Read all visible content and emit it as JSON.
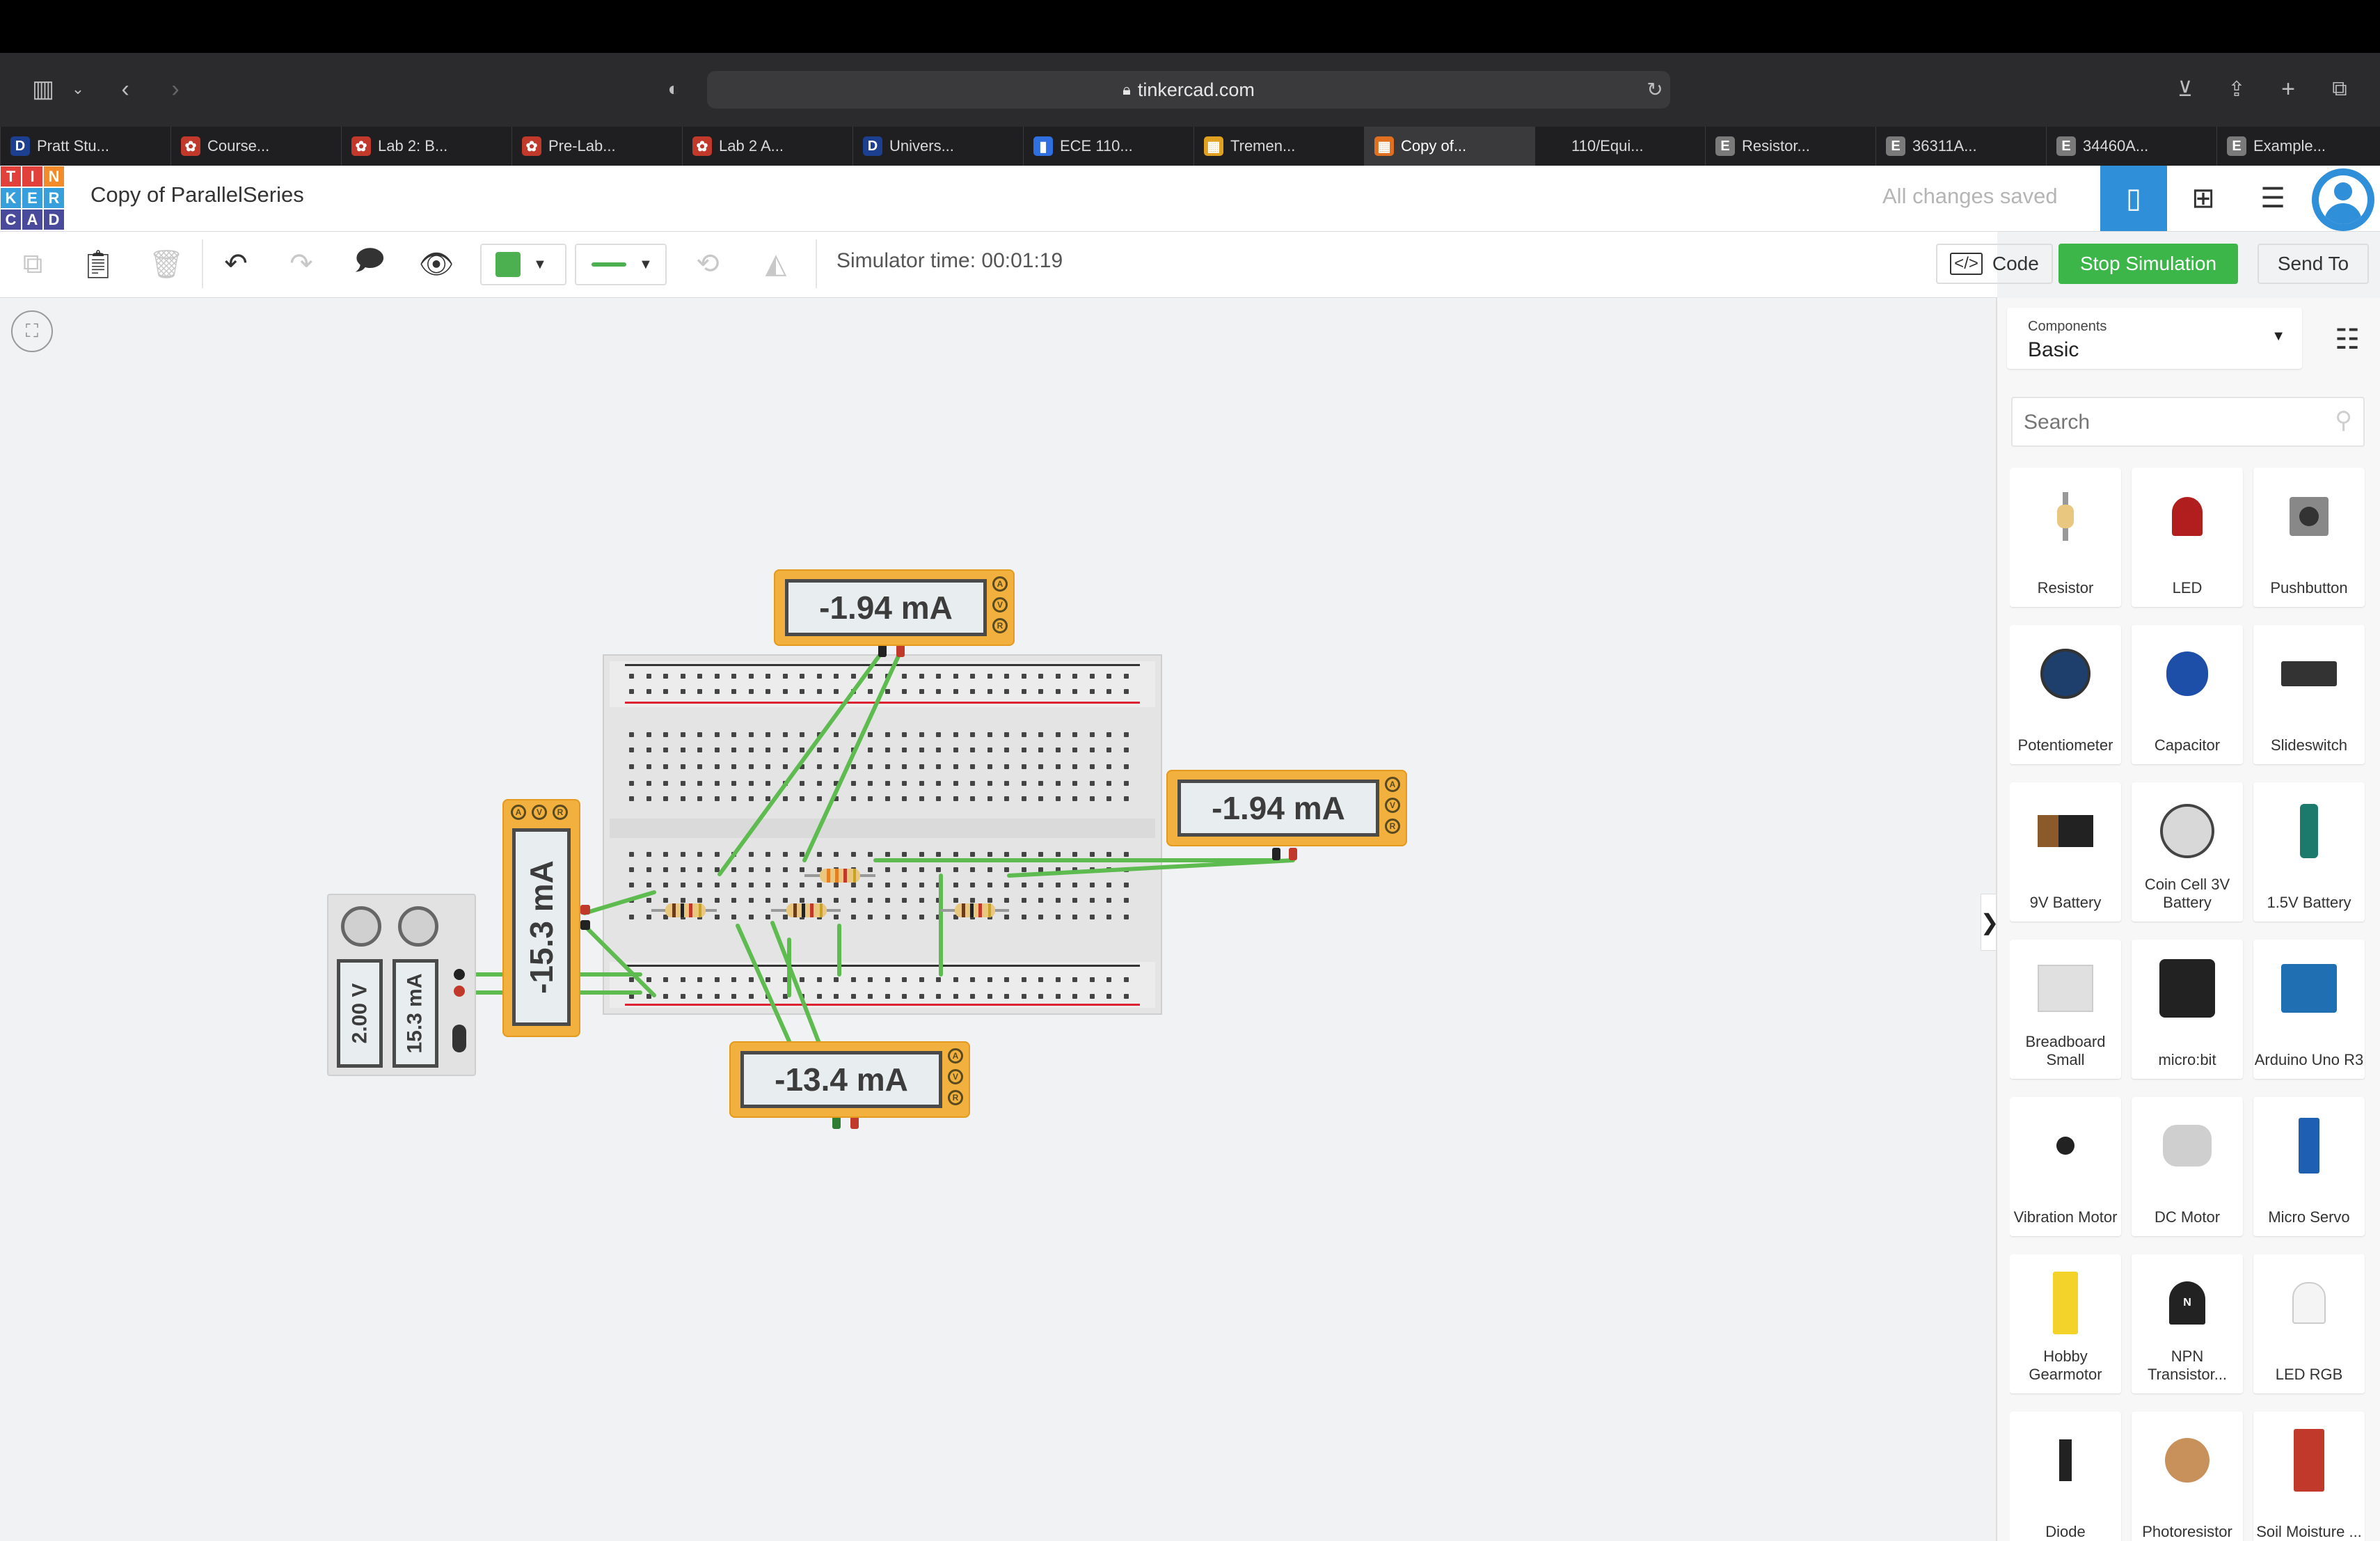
{
  "browser": {
    "url": "tinkercad.com",
    "tabs": [
      {
        "label": "Pratt Stu...",
        "icon": "D",
        "color": "#1d3f8f"
      },
      {
        "label": "Course...",
        "icon": "✿",
        "color": "#c0392b"
      },
      {
        "label": "Lab 2: B...",
        "icon": "✿",
        "color": "#c0392b"
      },
      {
        "label": "Pre-Lab...",
        "icon": "✿",
        "color": "#c0392b"
      },
      {
        "label": "Lab 2 A...",
        "icon": "✿",
        "color": "#c0392b"
      },
      {
        "label": "Univers...",
        "icon": "D",
        "color": "#1d3f8f"
      },
      {
        "label": "ECE 110...",
        "icon": "▮",
        "color": "#2f6fe0"
      },
      {
        "label": "Tremen...",
        "icon": "▦",
        "color": "#e0a020"
      },
      {
        "label": "Copy of...",
        "icon": "▦",
        "color": "#e07020"
      },
      {
        "label": "110/Equi...",
        "icon": "",
        "color": "#1f1f21"
      },
      {
        "label": "Resistor...",
        "icon": "E",
        "color": "#7a7a7a"
      },
      {
        "label": "36311A...",
        "icon": "E",
        "color": "#7a7a7a"
      },
      {
        "label": "34460A...",
        "icon": "E",
        "color": "#7a7a7a"
      },
      {
        "label": "Example...",
        "icon": "E",
        "color": "#7a7a7a"
      }
    ]
  },
  "app": {
    "logo": [
      "T",
      "I",
      "N",
      "K",
      "E",
      "R",
      "C",
      "A",
      "D"
    ],
    "title": "Copy of ParallelSeries",
    "save_status": "All changes saved"
  },
  "toolbar": {
    "simulator_time": "Simulator time: 00:01:19",
    "code_label": "Code",
    "stop_label": "Stop Simulation",
    "send_label": "Send To",
    "fill_color": "#4caf50",
    "wire_color": "#4caf50"
  },
  "circuit": {
    "power_supply": {
      "voltage": "2.00 V",
      "current": "15.3 mA"
    },
    "meter_main": "-15.3 mA",
    "meter_top": "-1.94 mA",
    "meter_right": "-1.94 mA",
    "meter_bottom": "-13.4 mA"
  },
  "panel": {
    "components_caption": "Components",
    "category": "Basic",
    "search_placeholder": "Search",
    "items": [
      {
        "label": "Resistor",
        "icon": "resistor-icon"
      },
      {
        "label": "LED",
        "icon": "led-icon"
      },
      {
        "label": "Pushbutton",
        "icon": "pushbutton-icon"
      },
      {
        "label": "Potentiometer",
        "icon": "potentiometer-icon"
      },
      {
        "label": "Capacitor",
        "icon": "capacitor-icon"
      },
      {
        "label": "Slideswitch",
        "icon": "slideswitch-icon"
      },
      {
        "label": "9V Battery",
        "icon": "battery-9v-icon"
      },
      {
        "label": "Coin Cell 3V Battery",
        "icon": "coin-cell-icon"
      },
      {
        "label": "1.5V Battery",
        "icon": "battery-aa-icon"
      },
      {
        "label": "Breadboard Small",
        "icon": "breadboard-icon"
      },
      {
        "label": "micro:bit",
        "icon": "microbit-icon"
      },
      {
        "label": "Arduino Uno R3",
        "icon": "arduino-icon"
      },
      {
        "label": "Vibration Motor",
        "icon": "vibration-motor-icon"
      },
      {
        "label": "DC Motor",
        "icon": "dc-motor-icon"
      },
      {
        "label": "Micro Servo",
        "icon": "servo-icon"
      },
      {
        "label": "Hobby Gearmotor",
        "icon": "gearmotor-icon"
      },
      {
        "label": "NPN Transistor...",
        "icon": "transistor-icon"
      },
      {
        "label": "LED RGB",
        "icon": "led-rgb-icon"
      },
      {
        "label": "Diode",
        "icon": "diode-icon"
      },
      {
        "label": "Photoresistor",
        "icon": "photoresistor-icon"
      },
      {
        "label": "Soil Moisture ...",
        "icon": "soil-sensor-icon"
      }
    ]
  }
}
